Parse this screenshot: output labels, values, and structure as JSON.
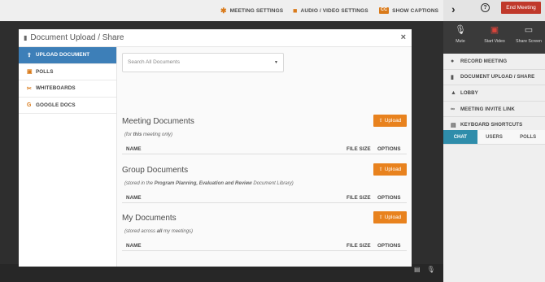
{
  "topbar": {
    "meeting_settings": "MEETING SETTINGS",
    "audio_video_settings": "AUDIO / VIDEO SETTINGS",
    "show_captions": "SHOW CAPTIONS",
    "cc_badge": "CC",
    "end_meeting": "End Meeting",
    "help": "?"
  },
  "media": {
    "mute": "Mute",
    "start_video": "Start Video",
    "share_screen": "Share Screen"
  },
  "sidebar": {
    "items": [
      {
        "label": "RECORD MEETING",
        "icon": "record-icon"
      },
      {
        "label": "DOCUMENT UPLOAD / SHARE",
        "icon": "document-icon"
      },
      {
        "label": "LOBBY",
        "icon": "lobby-icon"
      },
      {
        "label": "MEETING INVITE LINK",
        "icon": "link-icon"
      },
      {
        "label": "KEYBOARD SHORTCUTS",
        "icon": "keyboard-icon"
      }
    ],
    "tabs": [
      "CHAT",
      "USERS",
      "POLLS"
    ]
  },
  "modal": {
    "title": "Document Upload / Share",
    "close": "×",
    "nav": [
      {
        "label": "UPLOAD DOCUMENT",
        "icon": "upload-icon",
        "active": true
      },
      {
        "label": "POLLS",
        "icon": "polls-icon"
      },
      {
        "label": "WHITEBOARDS",
        "icon": "whiteboard-icon"
      },
      {
        "label": "GOOGLE DOCS",
        "icon": "google-icon"
      }
    ],
    "search_placeholder": "Search All Documents",
    "upload_label": "Upload",
    "columns": {
      "name": "NAME",
      "size": "FILE SIZE",
      "options": "OPTIONS"
    },
    "sections": [
      {
        "title": "Meeting Documents",
        "note_pre": "(for ",
        "note_bold": "this",
        "note_mid": " meeting only)",
        "note_bold2": "",
        "note_post": ""
      },
      {
        "title": "Group Documents",
        "note_pre": "(stored in the ",
        "note_bold": "Program Planning, Evaluation and Review",
        "note_mid": " Document Library)",
        "note_bold2": "",
        "note_post": ""
      },
      {
        "title": "My Documents",
        "note_pre": "(stored across ",
        "note_bold": "all",
        "note_mid": " my meetings)",
        "note_bold2": "",
        "note_post": ""
      }
    ]
  },
  "colors": {
    "accent_orange": "#e8821e",
    "active_blue": "#3d7fb8",
    "tab_teal": "#2f8dab",
    "end_red": "#c0392b"
  }
}
